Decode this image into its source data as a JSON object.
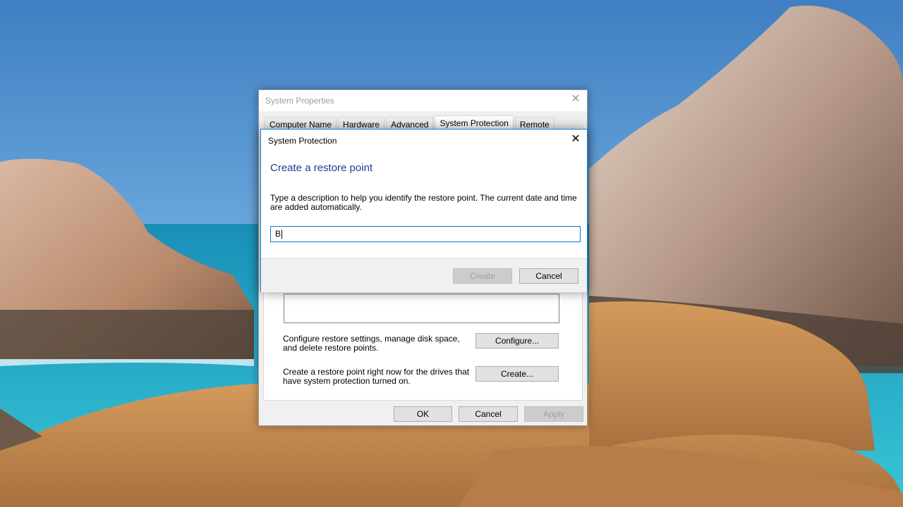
{
  "system_properties": {
    "title": "System Properties",
    "close_glyph": "✕",
    "tabs": [
      "Computer Name",
      "Hardware",
      "Advanced",
      "System Protection",
      "Remote"
    ],
    "active_tab": "System Protection",
    "configure_text": "Configure restore settings, manage disk space, and delete restore points.",
    "configure_button": "Configure...",
    "create_text": "Create a restore point right now for the drives that have system protection turned on.",
    "create_button": "Create...",
    "ok_button": "OK",
    "cancel_button": "Cancel",
    "apply_button": "Apply"
  },
  "system_protection_dialog": {
    "title": "System Protection",
    "close_glyph": "✕",
    "heading": "Create a restore point",
    "instruction": "Type a description to help you identify the restore point. The current date and time are added automatically.",
    "input_value": "B",
    "create_button": "Create",
    "cancel_button": "Cancel"
  },
  "colors": {
    "accent": "#0078d7",
    "heading": "#1e3f8f",
    "sky": "#4a88c8",
    "sea": "#1bb3cf"
  }
}
